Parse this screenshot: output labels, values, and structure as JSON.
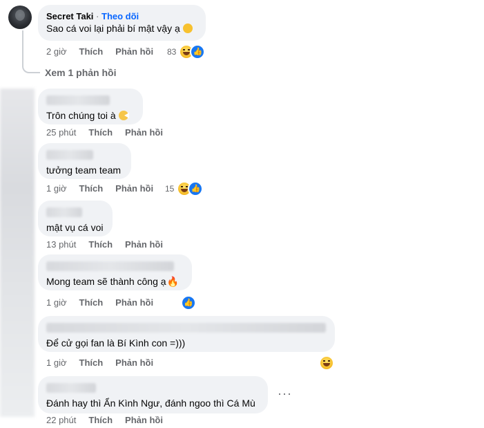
{
  "comments": [
    {
      "author": "Secret Taki",
      "separator": "·",
      "follow_label": "Theo dõi",
      "text": "Sao cá voi lại phải bí mật vậy ạ",
      "time": "2 giờ",
      "like_label": "Thích",
      "reply_label": "Phản hồi",
      "reaction_count": "83"
    },
    {
      "text": "Trôn chúng toi à",
      "time": "25 phút",
      "like_label": "Thích",
      "reply_label": "Phản hồi"
    },
    {
      "text": "tưởng team team",
      "time": "1 giờ",
      "like_label": "Thích",
      "reply_label": "Phản hồi",
      "reaction_count": "15"
    },
    {
      "text": "mật vụ cá voi",
      "time": "13 phút",
      "like_label": "Thích",
      "reply_label": "Phản hồi"
    },
    {
      "text": "Mong team sẽ thành công ạ",
      "time": "1 giờ",
      "like_label": "Thích",
      "reply_label": "Phản hồi"
    },
    {
      "text": "Để cử gọi fan là Bí Kình con =)))",
      "time": "1 giờ",
      "like_label": "Thích",
      "reply_label": "Phản hồi"
    },
    {
      "text": "Đánh hay thì Ẩn Kình Ngư, đánh ngoo thì Cá Mù",
      "time": "22 phút",
      "like_label": "Thích",
      "reply_label": "Phản hồi"
    }
  ],
  "view_replies_label": "Xem 1 phản hồi",
  "more_options": "···",
  "icons": {
    "haha": "haha-emoji-icon",
    "like": "like-thumb-icon",
    "more": "more-options-icon"
  },
  "colors": {
    "bubble": "#f0f2f5",
    "meta_text": "#65676b",
    "follow_link": "#0866ff",
    "like_blue": "#1877f2"
  }
}
